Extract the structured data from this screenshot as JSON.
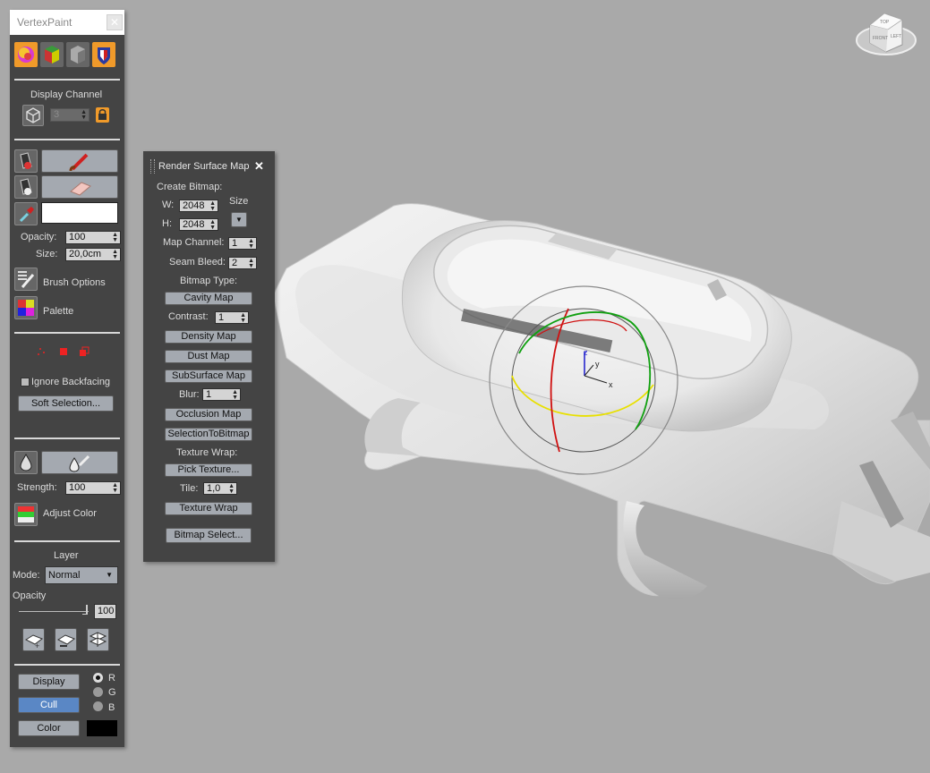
{
  "vertex_paint": {
    "title": "VertexPaint",
    "display_channel_label": "Display Channel",
    "channel_value": "3",
    "opacity_label": "Opacity:",
    "opacity_value": "100",
    "size_label": "Size:",
    "size_value": "20,0cm",
    "brush_options_label": "Brush Options",
    "palette_label": "Palette",
    "ignore_backfacing_label": "Ignore Backfacing",
    "soft_selection_label": "Soft Selection...",
    "strength_label": "Strength:",
    "strength_value": "100",
    "adjust_color_label": "Adjust Color",
    "layer_heading": "Layer",
    "mode_label": "Mode:",
    "mode_value": "Normal",
    "layer_opacity_label": "Opacity",
    "layer_opacity_value": "100",
    "display_button": "Display",
    "cull_button": "Cull",
    "color_button": "Color",
    "radio_r": "R",
    "radio_g": "G",
    "radio_b": "B",
    "paint_color": "#ffffff",
    "swatch_color": "#000000"
  },
  "render_surface_map": {
    "title": "Render Surface Map",
    "create_bitmap_label": "Create Bitmap:",
    "w_label": "W:",
    "w_value": "2048",
    "h_label": "H:",
    "h_value": "2048",
    "size_label": "Size",
    "map_channel_label": "Map Channel:",
    "map_channel_value": "1",
    "seam_bleed_label": "Seam Bleed:",
    "seam_bleed_value": "2",
    "bitmap_type_label": "Bitmap Type:",
    "cavity_map": "Cavity Map",
    "contrast_label": "Contrast:",
    "contrast_value": "1",
    "density_map": "Density Map",
    "dust_map": "Dust Map",
    "subsurface_map": "SubSurface Map",
    "blur_label": "Blur:",
    "blur_value": "1",
    "occlusion_map": "Occlusion Map",
    "selection_to_bitmap": "SelectionToBitmap",
    "texture_wrap_label": "Texture Wrap:",
    "pick_texture": "Pick Texture...",
    "tile_label": "Tile:",
    "tile_value": "1,0",
    "texture_wrap_button": "Texture Wrap",
    "bitmap_select": "Bitmap Select..."
  },
  "viewport": {
    "background": "#a9a9a9",
    "gizmo_axes": {
      "x": "x",
      "y": "y",
      "z": "z"
    },
    "viewcube_top": "TOP",
    "viewcube_front": "FRONT",
    "viewcube_left": "LEFT"
  }
}
